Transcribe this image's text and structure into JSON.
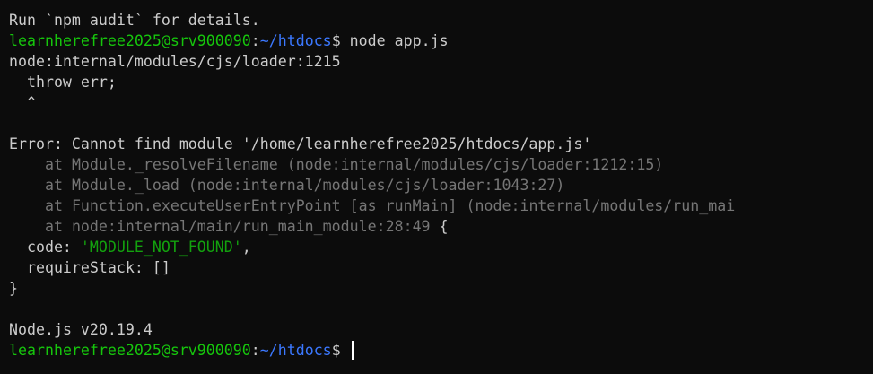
{
  "colors": {
    "background": "#0c0c0c",
    "foreground": "#cccccc",
    "prompt_user": "#16c60c",
    "prompt_path": "#3b78ff",
    "stack_dim": "#767676",
    "string": "#13a10e"
  },
  "audit_line": "Run `npm audit` for details.",
  "prompt": {
    "user_host": "learnherefree2025@srv900090",
    "colon": ":",
    "path": "~/htdocs",
    "symbol": "$ "
  },
  "command": "node app.js",
  "loader_line": "node:internal/modules/cjs/loader:1215",
  "throw_line": "throw err;",
  "caret_line": "^",
  "error_line": "Error: Cannot find module '/home/learnherefree2025/htdocs/app.js'",
  "stack": {
    "line1": {
      "at": "at ",
      "text": "Module._resolveFilename (node:internal/modules/cjs/loader:1212:15)"
    },
    "line2": {
      "at": "at ",
      "text": "Module._load (node:internal/modules/cjs/loader:1043:27)"
    },
    "line3": {
      "at": "at ",
      "text": "Function.executeUserEntryPoint [as runMain] (node:internal/modules/run_mai"
    },
    "line4": {
      "at": "at ",
      "text": "node:internal/main/run_main_module:28:49",
      "brace": " {"
    }
  },
  "code_line": {
    "key": "code: ",
    "value": "'MODULE_NOT_FOUND'",
    "suffix": ","
  },
  "require_stack_line": "requireStack: []",
  "closing_brace": "}",
  "node_version": "Node.js v20.19.4"
}
